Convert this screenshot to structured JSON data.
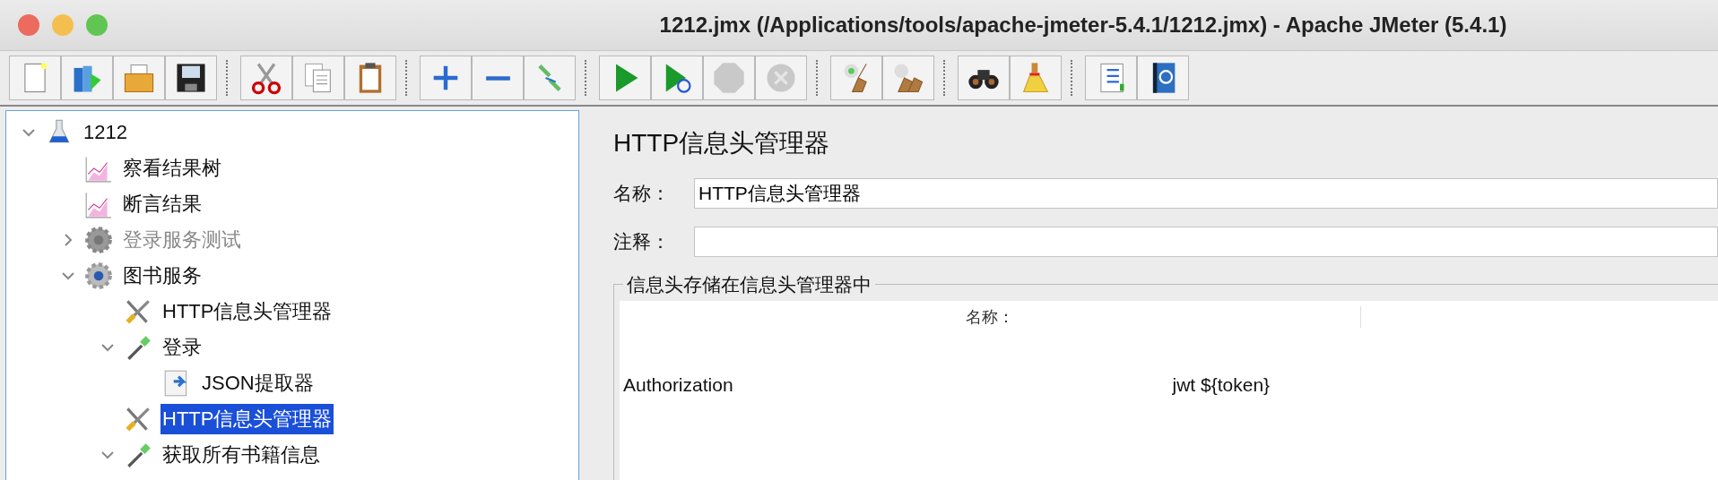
{
  "window": {
    "title": "1212.jmx (/Applications/tools/apache-jmeter-5.4.1/1212.jmx) - Apache JMeter (5.4.1)"
  },
  "toolbar": [
    [
      {
        "kind": "new",
        "disabled": false
      },
      {
        "kind": "templates",
        "disabled": false
      },
      {
        "kind": "open",
        "disabled": false
      },
      {
        "kind": "save",
        "disabled": false
      }
    ],
    [
      {
        "kind": "cut",
        "disabled": false
      },
      {
        "kind": "copy",
        "disabled": false
      },
      {
        "kind": "paste",
        "disabled": false
      }
    ],
    [
      {
        "kind": "expand",
        "disabled": false
      },
      {
        "kind": "collapse",
        "disabled": false
      },
      {
        "kind": "toggle",
        "disabled": false
      }
    ],
    [
      {
        "kind": "start",
        "disabled": false
      },
      {
        "kind": "start-no-pauses",
        "disabled": false
      },
      {
        "kind": "stop",
        "disabled": true
      },
      {
        "kind": "shutdown",
        "disabled": true
      }
    ],
    [
      {
        "kind": "clear",
        "disabled": false
      },
      {
        "kind": "clear-all",
        "disabled": false
      }
    ],
    [
      {
        "kind": "search",
        "disabled": false
      },
      {
        "kind": "reset-search",
        "disabled": false
      }
    ],
    [
      {
        "kind": "functions",
        "disabled": false
      },
      {
        "kind": "help",
        "disabled": false
      }
    ]
  ],
  "tree": [
    {
      "label": "1212",
      "kind": "test-plan",
      "expanded": true,
      "disabled": false,
      "selected": false,
      "children": [
        {
          "label": "察看结果树",
          "kind": "listener",
          "disabled": false,
          "selected": false
        },
        {
          "label": "断言结果",
          "kind": "listener",
          "disabled": false,
          "selected": false
        },
        {
          "label": "登录服务测试",
          "kind": "thread-group",
          "expanded": false,
          "disabled": true,
          "selected": false
        },
        {
          "label": "图书服务",
          "kind": "thread-group",
          "expanded": true,
          "disabled": false,
          "selected": false,
          "children": [
            {
              "label": "HTTP信息头管理器",
              "kind": "config",
              "disabled": false,
              "selected": false
            },
            {
              "label": "登录",
              "kind": "sampler",
              "expanded": true,
              "disabled": false,
              "selected": false,
              "children": [
                {
                  "label": "JSON提取器",
                  "kind": "post-processor",
                  "disabled": false,
                  "selected": false
                }
              ]
            },
            {
              "label": "HTTP信息头管理器",
              "kind": "config",
              "disabled": false,
              "selected": true
            },
            {
              "label": "获取所有书籍信息",
              "kind": "sampler",
              "expanded": true,
              "disabled": false,
              "selected": false
            }
          ]
        }
      ]
    }
  ],
  "panel": {
    "title": "HTTP信息头管理器",
    "name": {
      "label": "名称：",
      "value": "HTTP信息头管理器"
    },
    "comment": {
      "label": "注释："
    },
    "group_title": "信息头存储在信息头管理器中",
    "table": {
      "columns": [
        "名称："
      ],
      "rows": [
        {
          "cells": [
            "Authorization",
            "jwt ${token}"
          ]
        }
      ]
    }
  }
}
